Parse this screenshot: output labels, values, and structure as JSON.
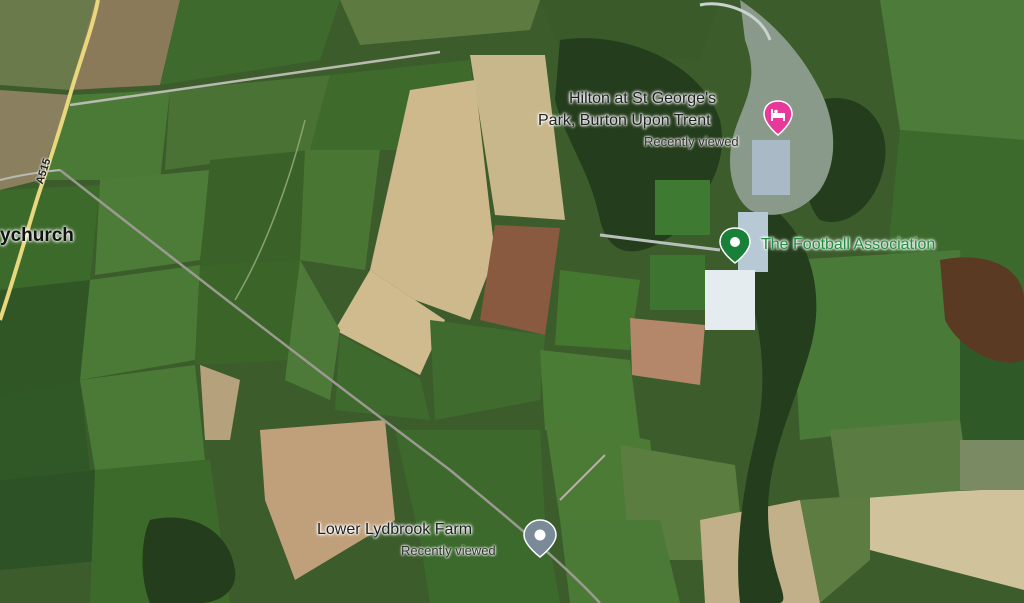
{
  "colors": {
    "hotel_pin": "#e8389a",
    "green_pin": "#188038",
    "grey_pin": "#7a8a99",
    "green_label": "#1e8e3e"
  },
  "places": {
    "town_partial": "ychurch",
    "road": "A515"
  },
  "pins": {
    "hotel": {
      "icon": "bed-icon",
      "title_line1": "Hilton at St George's",
      "title_line2": "Park, Burton Upon Trent",
      "subtitle": "Recently viewed"
    },
    "fa": {
      "icon": "green-dot-pin-icon",
      "title": "The Football Association"
    },
    "farm": {
      "icon": "grey-dot-pin-icon",
      "title": "Lower Lydbrook Farm",
      "subtitle": "Recently viewed"
    }
  }
}
